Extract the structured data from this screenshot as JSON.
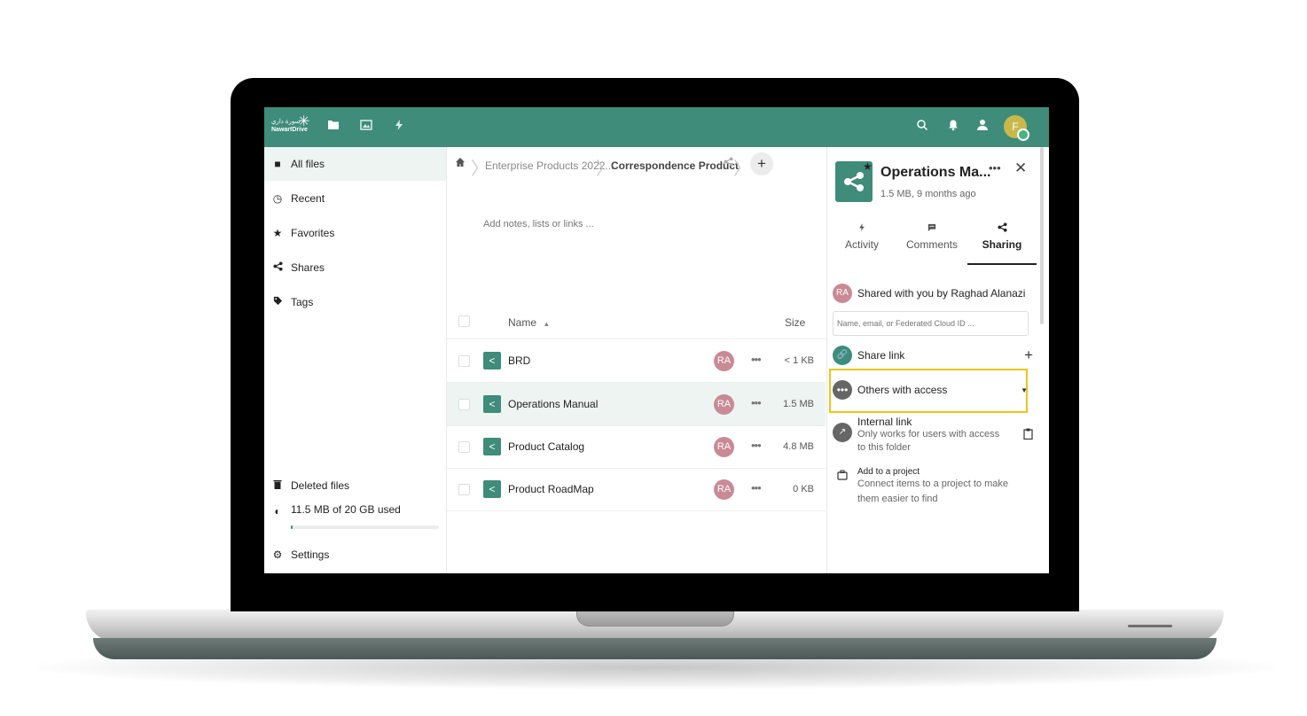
{
  "app": {
    "logo_text_ar": "سورة داري",
    "logo_text_en": "NawartDrive"
  },
  "topbar": {
    "icons": [
      "files-icon",
      "photos-icon",
      "activity-icon",
      "search-icon",
      "bell-icon",
      "contacts-icon"
    ],
    "avatar_initial": "F"
  },
  "sidebar": {
    "items": [
      {
        "label": "All files",
        "icon": "folder-icon"
      },
      {
        "label": "Recent",
        "icon": "clock-icon"
      },
      {
        "label": "Favorites",
        "icon": "star-icon"
      },
      {
        "label": "Shares",
        "icon": "share-icon"
      },
      {
        "label": "Tags",
        "icon": "tag-icon"
      }
    ],
    "deleted_label": "Deleted files",
    "quota_label": "11.5 MB of 20 GB used",
    "quota_fraction": 0.01,
    "settings_label": "Settings"
  },
  "breadcrumb": {
    "items": [
      "Enterprise Products 2022...",
      "Correspondence Product"
    ]
  },
  "main": {
    "notes_placeholder": "Add notes, lists or links ...",
    "columns": {
      "name": "Name",
      "size": "Size"
    },
    "files": [
      {
        "name": "BRD",
        "owner": "RA",
        "size": "< 1 KB"
      },
      {
        "name": "Operations Manual",
        "owner": "RA",
        "size": "1.5 MB"
      },
      {
        "name": "Product Catalog",
        "owner": "RA",
        "size": "4.8 MB"
      },
      {
        "name": "Product RoadMap",
        "owner": "RA",
        "size": "0 KB"
      }
    ]
  },
  "details": {
    "title": "Operations Ma...",
    "subtitle": "1.5 MB, 9 months ago",
    "tabs": [
      {
        "label": "Activity",
        "icon": "activity-icon"
      },
      {
        "label": "Comments",
        "icon": "comment-icon"
      },
      {
        "label": "Sharing",
        "icon": "share-icon"
      }
    ],
    "shared_by_initials": "RA",
    "shared_by_text": "Shared with you by Raghad Alanazi",
    "share_input_placeholder": "Name, email, or Federated Cloud ID ...",
    "share_link_label": "Share link",
    "others_label": "Others with access",
    "internal_link_title": "Internal link",
    "internal_link_desc": "Only works for users with access to this folder",
    "project_title": "Add to a project",
    "project_desc": "Connect items to a project to make them easier to find"
  },
  "colors": {
    "brand": "#3e8c79",
    "avatar_owner": "#c98a96",
    "highlight": "#f0c419"
  }
}
